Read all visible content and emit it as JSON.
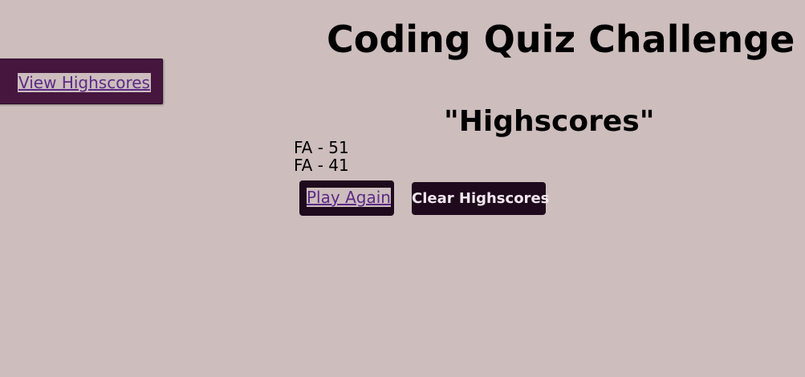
{
  "header": {
    "title": "Coding Quiz Challenge",
    "view_highscores_label": "View Highscores"
  },
  "highscores": {
    "heading": "\"Highscores\"",
    "entries": [
      "FA - 51",
      "FA - 41"
    ]
  },
  "actions": {
    "play_again_label": "Play Again",
    "clear_highscores_label": "Clear Highscores"
  },
  "colors": {
    "background": "#cdbdbd",
    "button_dark": "#1e0a1c",
    "view_button": "#46163f",
    "link": "#5c2a86"
  }
}
